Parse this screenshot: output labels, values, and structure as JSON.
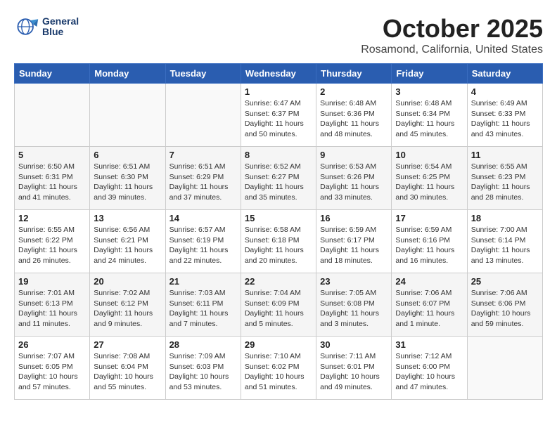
{
  "header": {
    "logo_line1": "General",
    "logo_line2": "Blue",
    "month": "October 2025",
    "location": "Rosamond, California, United States"
  },
  "weekdays": [
    "Sunday",
    "Monday",
    "Tuesday",
    "Wednesday",
    "Thursday",
    "Friday",
    "Saturday"
  ],
  "weeks": [
    [
      {
        "day": "",
        "content": ""
      },
      {
        "day": "",
        "content": ""
      },
      {
        "day": "",
        "content": ""
      },
      {
        "day": "1",
        "content": "Sunrise: 6:47 AM\nSunset: 6:37 PM\nDaylight: 11 hours\nand 50 minutes."
      },
      {
        "day": "2",
        "content": "Sunrise: 6:48 AM\nSunset: 6:36 PM\nDaylight: 11 hours\nand 48 minutes."
      },
      {
        "day": "3",
        "content": "Sunrise: 6:48 AM\nSunset: 6:34 PM\nDaylight: 11 hours\nand 45 minutes."
      },
      {
        "day": "4",
        "content": "Sunrise: 6:49 AM\nSunset: 6:33 PM\nDaylight: 11 hours\nand 43 minutes."
      }
    ],
    [
      {
        "day": "5",
        "content": "Sunrise: 6:50 AM\nSunset: 6:31 PM\nDaylight: 11 hours\nand 41 minutes."
      },
      {
        "day": "6",
        "content": "Sunrise: 6:51 AM\nSunset: 6:30 PM\nDaylight: 11 hours\nand 39 minutes."
      },
      {
        "day": "7",
        "content": "Sunrise: 6:51 AM\nSunset: 6:29 PM\nDaylight: 11 hours\nand 37 minutes."
      },
      {
        "day": "8",
        "content": "Sunrise: 6:52 AM\nSunset: 6:27 PM\nDaylight: 11 hours\nand 35 minutes."
      },
      {
        "day": "9",
        "content": "Sunrise: 6:53 AM\nSunset: 6:26 PM\nDaylight: 11 hours\nand 33 minutes."
      },
      {
        "day": "10",
        "content": "Sunrise: 6:54 AM\nSunset: 6:25 PM\nDaylight: 11 hours\nand 30 minutes."
      },
      {
        "day": "11",
        "content": "Sunrise: 6:55 AM\nSunset: 6:23 PM\nDaylight: 11 hours\nand 28 minutes."
      }
    ],
    [
      {
        "day": "12",
        "content": "Sunrise: 6:55 AM\nSunset: 6:22 PM\nDaylight: 11 hours\nand 26 minutes."
      },
      {
        "day": "13",
        "content": "Sunrise: 6:56 AM\nSunset: 6:21 PM\nDaylight: 11 hours\nand 24 minutes."
      },
      {
        "day": "14",
        "content": "Sunrise: 6:57 AM\nSunset: 6:19 PM\nDaylight: 11 hours\nand 22 minutes."
      },
      {
        "day": "15",
        "content": "Sunrise: 6:58 AM\nSunset: 6:18 PM\nDaylight: 11 hours\nand 20 minutes."
      },
      {
        "day": "16",
        "content": "Sunrise: 6:59 AM\nSunset: 6:17 PM\nDaylight: 11 hours\nand 18 minutes."
      },
      {
        "day": "17",
        "content": "Sunrise: 6:59 AM\nSunset: 6:16 PM\nDaylight: 11 hours\nand 16 minutes."
      },
      {
        "day": "18",
        "content": "Sunrise: 7:00 AM\nSunset: 6:14 PM\nDaylight: 11 hours\nand 13 minutes."
      }
    ],
    [
      {
        "day": "19",
        "content": "Sunrise: 7:01 AM\nSunset: 6:13 PM\nDaylight: 11 hours\nand 11 minutes."
      },
      {
        "day": "20",
        "content": "Sunrise: 7:02 AM\nSunset: 6:12 PM\nDaylight: 11 hours\nand 9 minutes."
      },
      {
        "day": "21",
        "content": "Sunrise: 7:03 AM\nSunset: 6:11 PM\nDaylight: 11 hours\nand 7 minutes."
      },
      {
        "day": "22",
        "content": "Sunrise: 7:04 AM\nSunset: 6:09 PM\nDaylight: 11 hours\nand 5 minutes."
      },
      {
        "day": "23",
        "content": "Sunrise: 7:05 AM\nSunset: 6:08 PM\nDaylight: 11 hours\nand 3 minutes."
      },
      {
        "day": "24",
        "content": "Sunrise: 7:06 AM\nSunset: 6:07 PM\nDaylight: 11 hours\nand 1 minute."
      },
      {
        "day": "25",
        "content": "Sunrise: 7:06 AM\nSunset: 6:06 PM\nDaylight: 10 hours\nand 59 minutes."
      }
    ],
    [
      {
        "day": "26",
        "content": "Sunrise: 7:07 AM\nSunset: 6:05 PM\nDaylight: 10 hours\nand 57 minutes."
      },
      {
        "day": "27",
        "content": "Sunrise: 7:08 AM\nSunset: 6:04 PM\nDaylight: 10 hours\nand 55 minutes."
      },
      {
        "day": "28",
        "content": "Sunrise: 7:09 AM\nSunset: 6:03 PM\nDaylight: 10 hours\nand 53 minutes."
      },
      {
        "day": "29",
        "content": "Sunrise: 7:10 AM\nSunset: 6:02 PM\nDaylight: 10 hours\nand 51 minutes."
      },
      {
        "day": "30",
        "content": "Sunrise: 7:11 AM\nSunset: 6:01 PM\nDaylight: 10 hours\nand 49 minutes."
      },
      {
        "day": "31",
        "content": "Sunrise: 7:12 AM\nSunset: 6:00 PM\nDaylight: 10 hours\nand 47 minutes."
      },
      {
        "day": "",
        "content": ""
      }
    ]
  ]
}
